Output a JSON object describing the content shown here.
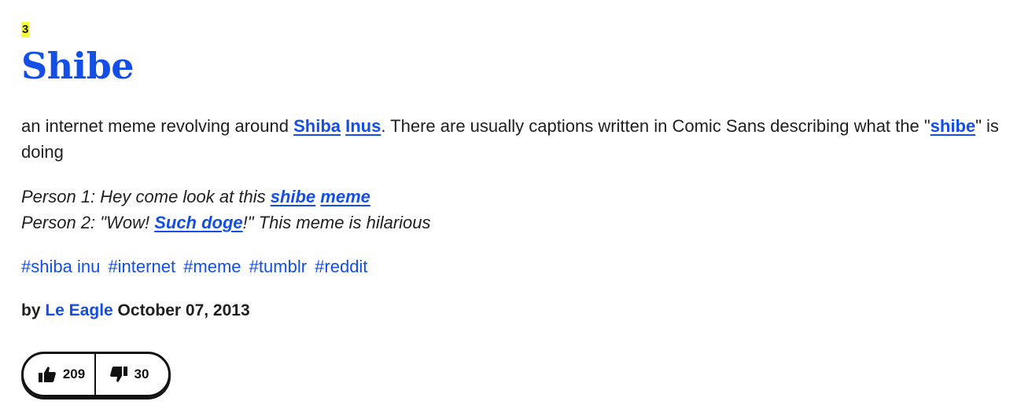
{
  "definition": {
    "rank": "3",
    "word": "Shibe",
    "meaning": {
      "text_before": "an internet meme revolving around ",
      "link1": "Shiba",
      "space1": " ",
      "link2": "Inus",
      "text_middle": ". There are usually captions written in Comic Sans describing what the \"",
      "link3": "shibe",
      "text_after": "\" is doing"
    },
    "example": {
      "line1_before": "Person 1: Hey come look at this ",
      "line1_link1": "shibe",
      "line1_space": " ",
      "line1_link2": "meme",
      "line2_before": "Person 2: \"Wow! ",
      "line2_link": "Such doge",
      "line2_after": "!\" This meme is hilarious"
    },
    "tags": [
      "#shiba inu",
      "#internet",
      "#meme",
      "#tumblr",
      "#reddit"
    ],
    "byline": {
      "prefix": "by ",
      "author": "Le Eagle",
      "date": " October 07, 2013"
    },
    "votes": {
      "up_icon": "thumbs-up-icon",
      "up_count": "209",
      "down_icon": "thumbs-down-icon",
      "down_count": "30"
    },
    "colors": {
      "accent": "#134fe6",
      "rank_highlight": "#f2ff3a",
      "text": "#1f1f1f"
    }
  }
}
